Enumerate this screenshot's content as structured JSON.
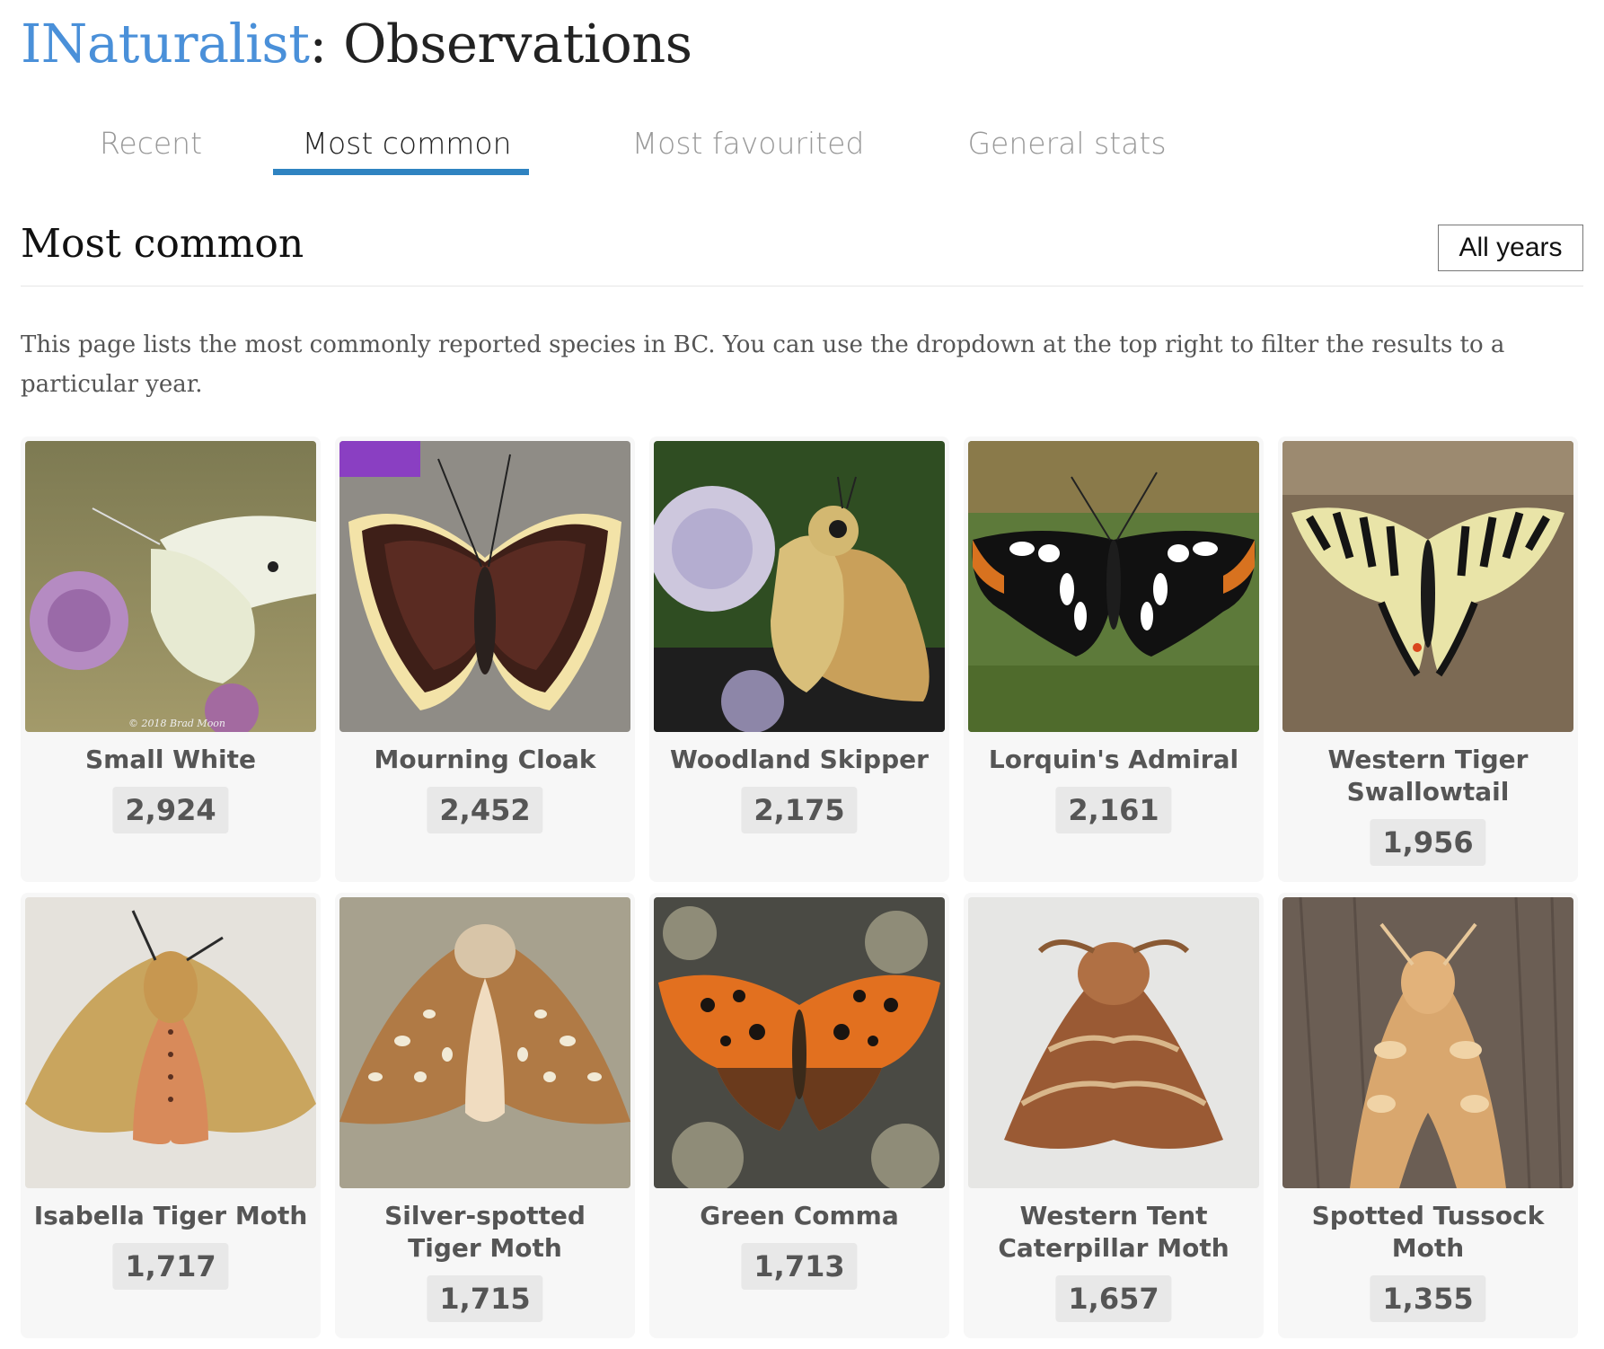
{
  "header": {
    "brand": "INaturalist",
    "separator": ":",
    "section": " Observations"
  },
  "tabs": [
    {
      "label": "Recent",
      "active": false
    },
    {
      "label": "Most common",
      "active": true
    },
    {
      "label": "Most favourited",
      "active": false
    },
    {
      "label": "General stats",
      "active": false
    }
  ],
  "main": {
    "title": "Most common",
    "year_filter": "All years",
    "intro": "This page lists the most commonly reported species in BC. You can use the dropdown at the top right to filter the results to a particular year."
  },
  "species": [
    {
      "name": "Small White",
      "count": "2,924"
    },
    {
      "name": "Mourning Cloak",
      "count": "2,452"
    },
    {
      "name": "Woodland Skipper",
      "count": "2,175"
    },
    {
      "name": "Lorquin's Admiral",
      "count": "2,161"
    },
    {
      "name": "Western Tiger Swallowtail",
      "count": "1,956"
    },
    {
      "name": "Isabella Tiger Moth",
      "count": "1,717"
    },
    {
      "name": "Silver-spotted Tiger Moth",
      "count": "1,715"
    },
    {
      "name": "Green Comma",
      "count": "1,713"
    },
    {
      "name": "Western Tent Caterpillar Moth",
      "count": "1,657"
    },
    {
      "name": "Spotted Tussock Moth",
      "count": "1,355"
    }
  ],
  "photo_credit": "© 2018 Brad Moon",
  "colors": {
    "brand": "#4a90d9",
    "tab_active_underline": "#2f83c1"
  }
}
